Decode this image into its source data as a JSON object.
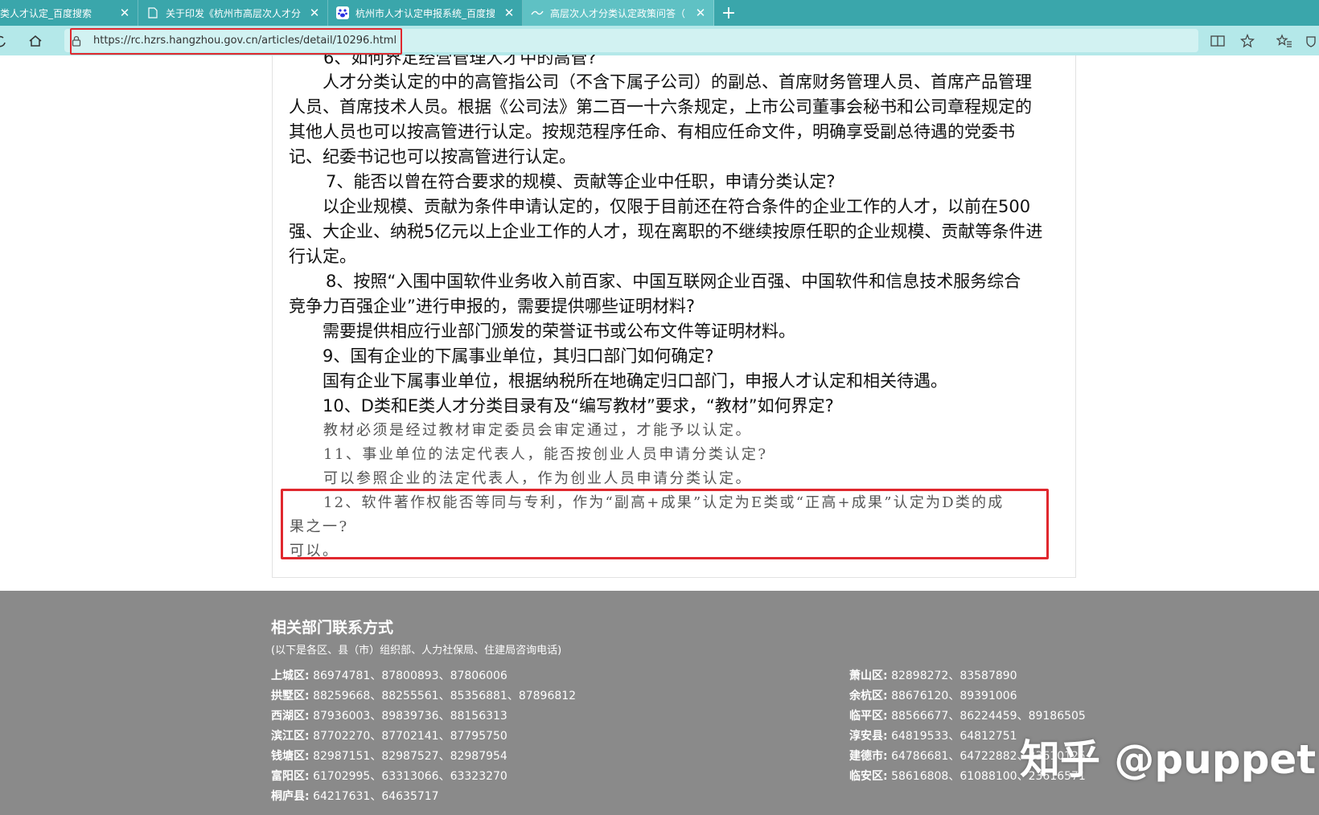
{
  "browser": {
    "tabs": [
      {
        "title": "类人才认定_百度搜索",
        "icon": "search-page-icon"
      },
      {
        "title": "关于印发《杭州市高层次人才分",
        "icon": "document-icon"
      },
      {
        "title": "杭州市人才认定申报系统_百度搜",
        "icon": "baidu-paw-icon"
      },
      {
        "title": "高层次人才分类认定政策问答（",
        "icon": "site-favicon"
      }
    ],
    "new_tab_label": "+",
    "url": "https://rc.hzrs.hangzhou.gov.cn/articles/detail/10296.html",
    "highlight_color": "#e0282e"
  },
  "article": {
    "cut_top_line": "6、如何界定经营管理人才中的高管?",
    "lines": [
      "人才分类认定的中的高管指公司（不含下属子公司）的副总、首席财务管理人员、首席产品管理",
      "人员、首席技术人员。根据《公司法》第二百一十六条规定，上市公司董事会秘书和公司章程规定的",
      "其他人员也可以按高管进行认定。按规范程序任命、有相应任命文件，明确享受副总待遇的党委书",
      "记、纪委书记也可以按高管进行认定。",
      "7、能否以曾在符合要求的规模、贡献等企业中任职，申请分类认定?",
      "以企业规模、贡献为条件申请认定的，仅限于目前还在符合条件的企业工作的人才，以前在500",
      "强、大企业、纳税5亿元以上企业工作的人才，现在离职的不继续按原任职的企业规模、贡献等条件进",
      "行认定。",
      "8、按照“入围中国软件业务收入前百家、中国互联网企业百强、中国软件和信息技术服务综合",
      "竞争力百强企业”进行申报的，需要提供哪些证明材料?",
      "需要提供相应行业部门颁发的荣誉证书或公布文件等证明材料。",
      "9、国有企业的下属事业单位，其归口部门如何确定?",
      "国有企业下属事业单位，根据纳税所在地确定归口部门，申报人才认定和相关待遇。",
      "10、D类和E类人才分类目录有及“编写教材”要求，“教材”如何界定?",
      "教材必须是经过教材审定委员会审定通过，才能予以认定。",
      "11、事业单位的法定代表人，能否按创业人员申请分类认定?",
      "可以参照企业的法定代表人，作为创业人员申请分类认定。",
      "12、软件著作权能否等同与专利，作为“副高+成果”认定为E类或“正高+成果”认定为D类的成",
      "果之一?",
      "可以。"
    ]
  },
  "footer": {
    "title": "相关部门联系方式",
    "subtitle": "(以下是各区、县（市）组织部、人力社保局、住建局咨询电话)",
    "left_contacts": [
      {
        "district": "上城区:",
        "phones": "86974781、87800893、87806006"
      },
      {
        "district": "拱墅区:",
        "phones": "88259668、88255561、85356881、87896812"
      },
      {
        "district": "西湖区:",
        "phones": "87936003、89839736、88156313"
      },
      {
        "district": "滨江区:",
        "phones": "87702270、87702141、87795750"
      },
      {
        "district": "钱塘区:",
        "phones": "82987151、82987527、82987954"
      },
      {
        "district": "富阳区:",
        "phones": "61702995、63313066、63323270"
      },
      {
        "district": "桐庐县:",
        "phones": "64217631、64635717"
      }
    ],
    "right_contacts": [
      {
        "district": "萧山区:",
        "phones": "82898272、83587890"
      },
      {
        "district": "余杭区:",
        "phones": "88676120、89391006"
      },
      {
        "district": "临平区:",
        "phones": "88566677、86224459、89186505"
      },
      {
        "district": "淳安县:",
        "phones": "64819533、64812751"
      },
      {
        "district": "建德市:",
        "phones": "64786681、64722882、23610125"
      },
      {
        "district": "临安区:",
        "phones": "58616808、61088100、23616571"
      }
    ],
    "background_color": "#8a8a8a"
  },
  "watermark": "知乎 @puppet"
}
